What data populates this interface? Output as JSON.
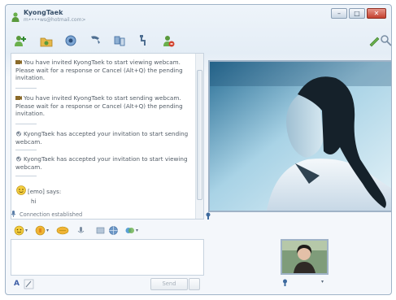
{
  "window": {
    "title": "KyongTaek",
    "subtitle": "m••••ws@hotmail.com>",
    "controls": {
      "minimize": "–",
      "maximize": "□",
      "close": "✕"
    }
  },
  "toolbar": {
    "icons": [
      "invite-contact-icon",
      "share-folder-icon",
      "video-call-icon",
      "voice-call-icon",
      "activities-icon",
      "games-icon",
      "block-icon",
      "settings-pen-icon",
      "search-icon"
    ]
  },
  "history": {
    "messages": [
      "You have invited KyongTaek to start viewing webcam. Please wait for a response or Cancel (Alt+Q) the pending invitation.",
      "You have invited KyongTaek to start sending webcam. Please wait for a response or Cancel (Alt+Q) the pending invitation.",
      "KyongTaek has accepted your invitation to start sending webcam.",
      "KyongTaek has accepted your invitation to start viewing webcam."
    ],
    "nick_line": "[emo] says:",
    "hi_text": "hi",
    "status": "Connection established"
  },
  "compose": {
    "font_label": "A",
    "send_label": "Send"
  },
  "colors": {
    "accent": "#38506a",
    "window_border": "#9fb3c7",
    "close_red": "#c4412f"
  }
}
